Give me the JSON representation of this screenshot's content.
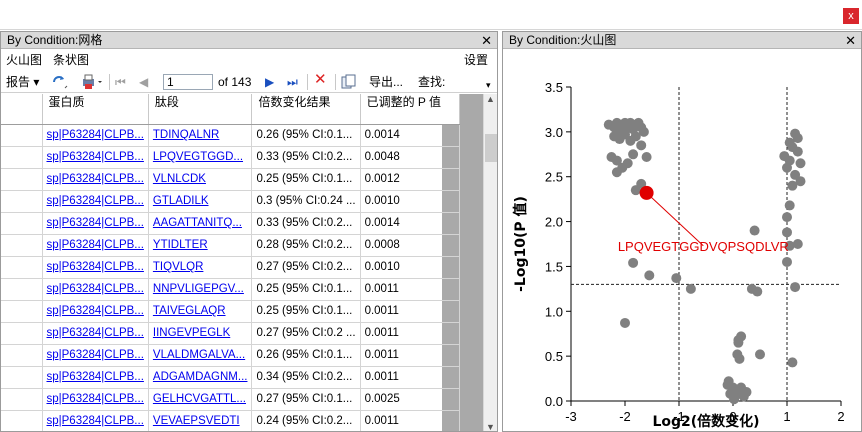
{
  "window": {
    "close_glyph": "x"
  },
  "left_pane": {
    "title": "By Condition:网格",
    "close_glyph": "✕",
    "menu": {
      "volcano": "火山图",
      "bar": "条状图",
      "settings": "设置"
    },
    "toolbar": {
      "report": "报告",
      "page_value": "1",
      "page_of": "of 143",
      "export": "导出...",
      "find": "查找:"
    },
    "columns": [
      "蛋白质",
      "肽段",
      "倍数变化结果",
      "已调整的 P 值"
    ],
    "rows": [
      [
        "sp|P63284|CLPB...",
        "TDINQALNR",
        "0.26 (95% CI:0.1...",
        "0.0014"
      ],
      [
        "sp|P63284|CLPB...",
        "LPQVEGTGGD...",
        "0.33 (95% CI:0.2...",
        "0.0048"
      ],
      [
        "sp|P63284|CLPB...",
        "VLNLCDK",
        "0.25 (95% CI:0.1...",
        "0.0012"
      ],
      [
        "sp|P63284|CLPB...",
        "GTLADILK",
        "0.3 (95% CI:0.24 ...",
        "0.0010"
      ],
      [
        "sp|P63284|CLPB...",
        "AAGATTANITQ...",
        "0.33 (95% CI:0.2...",
        "0.0014"
      ],
      [
        "sp|P63284|CLPB...",
        "YTIDLTER",
        "0.28 (95% CI:0.2...",
        "0.0008"
      ],
      [
        "sp|P63284|CLPB...",
        "TIQVLQR",
        "0.27 (95% CI:0.2...",
        "0.0010"
      ],
      [
        "sp|P63284|CLPB...",
        "NNPVLIGEPGV...",
        "0.25 (95% CI:0.1...",
        "0.0011"
      ],
      [
        "sp|P63284|CLPB...",
        "TAIVEGLAQR",
        "0.25 (95% CI:0.1...",
        "0.0011"
      ],
      [
        "sp|P63284|CLPB...",
        "IINGEVPEGLK",
        "0.27 (95% CI:0.2 ...",
        "0.0011"
      ],
      [
        "sp|P63284|CLPB...",
        "VLALDMGALVA...",
        "0.26 (95% CI:0.1...",
        "0.0011"
      ],
      [
        "sp|P63284|CLPB...",
        "ADGAMDAGNM...",
        "0.34 (95% CI:0.2...",
        "0.0011"
      ],
      [
        "sp|P63284|CLPB...",
        "GELHCVGATTL...",
        "0.27 (95% CI:0.1...",
        "0.0025"
      ],
      [
        "sp|P63284|CLPB...",
        "VEVAEPSVEDTI",
        "0.24 (95% CI:0.2...",
        "0.0011"
      ]
    ]
  },
  "right_pane": {
    "title": "By Condition:火山图",
    "close_glyph": "✕"
  },
  "chart_data": {
    "type": "scatter",
    "xlabel": "Log2(倍数变化)",
    "ylabel": "-Log10(P 值)",
    "xlim": [
      -3,
      2
    ],
    "ylim": [
      0,
      3.5
    ],
    "xticks": [
      "-3",
      "-2",
      "-1",
      "0",
      "1",
      "2"
    ],
    "yticks": [
      "0.0",
      "0.5",
      "1.0",
      "1.5",
      "2.0",
      "2.5",
      "3.0",
      "3.5"
    ],
    "threshold_x": [
      -1,
      1
    ],
    "threshold_y": 1.3,
    "point_color": "#808080",
    "highlight_color": "#e00000",
    "highlight": {
      "x": -1.6,
      "y": 2.32,
      "label": "LPQVEGTGGDVQPSQDLVR"
    },
    "points": [
      [
        -2.3,
        3.08
      ],
      [
        -2.2,
        3.05
      ],
      [
        -2.15,
        3.1
      ],
      [
        -2.1,
        3.02
      ],
      [
        -2.05,
        3.08
      ],
      [
        -2.0,
        3.1
      ],
      [
        -1.95,
        3.05
      ],
      [
        -1.9,
        3.1
      ],
      [
        -1.85,
        3.03
      ],
      [
        -1.8,
        3.08
      ],
      [
        -1.75,
        3.1
      ],
      [
        -1.7,
        3.05
      ],
      [
        -1.65,
        3.0
      ],
      [
        -2.2,
        2.95
      ],
      [
        -2.1,
        2.92
      ],
      [
        -2.0,
        2.97
      ],
      [
        -1.9,
        2.9
      ],
      [
        -1.8,
        2.95
      ],
      [
        -1.7,
        2.85
      ],
      [
        -2.25,
        2.72
      ],
      [
        -2.15,
        2.68
      ],
      [
        -2.05,
        2.6
      ],
      [
        -1.95,
        2.65
      ],
      [
        -1.85,
        2.75
      ],
      [
        -1.6,
        2.72
      ],
      [
        -2.15,
        2.55
      ],
      [
        -1.7,
        2.42
      ],
      [
        -1.8,
        2.35
      ],
      [
        -1.85,
        1.54
      ],
      [
        -1.55,
        1.4
      ],
      [
        -1.05,
        1.37
      ],
      [
        -0.78,
        1.25
      ],
      [
        -2.0,
        0.87
      ],
      [
        1.15,
        2.98
      ],
      [
        1.2,
        2.93
      ],
      [
        1.05,
        2.88
      ],
      [
        1.1,
        2.83
      ],
      [
        1.2,
        2.78
      ],
      [
        0.95,
        2.73
      ],
      [
        1.05,
        2.68
      ],
      [
        1.25,
        2.65
      ],
      [
        1.0,
        2.6
      ],
      [
        1.15,
        2.52
      ],
      [
        1.25,
        2.45
      ],
      [
        1.1,
        2.4
      ],
      [
        1.05,
        2.18
      ],
      [
        1.0,
        2.05
      ],
      [
        0.4,
        1.9
      ],
      [
        1.0,
        1.88
      ],
      [
        1.05,
        1.73
      ],
      [
        1.0,
        1.55
      ],
      [
        1.2,
        1.75
      ],
      [
        1.15,
        1.27
      ],
      [
        0.35,
        1.25
      ],
      [
        0.45,
        1.22
      ],
      [
        1.1,
        0.43
      ],
      [
        0.1,
        0.68
      ],
      [
        0.15,
        0.72
      ],
      [
        0.1,
        0.65
      ],
      [
        0.08,
        0.52
      ],
      [
        0.12,
        0.47
      ],
      [
        0.5,
        0.52
      ],
      [
        -0.08,
        0.22
      ],
      [
        -0.1,
        0.18
      ],
      [
        0.0,
        0.15
      ],
      [
        0.05,
        0.12
      ],
      [
        0.1,
        0.08
      ],
      [
        0.15,
        0.15
      ],
      [
        0.2,
        0.05
      ],
      [
        0.25,
        0.1
      ],
      [
        0.02,
        0.02
      ],
      [
        -0.05,
        0.08
      ]
    ]
  }
}
